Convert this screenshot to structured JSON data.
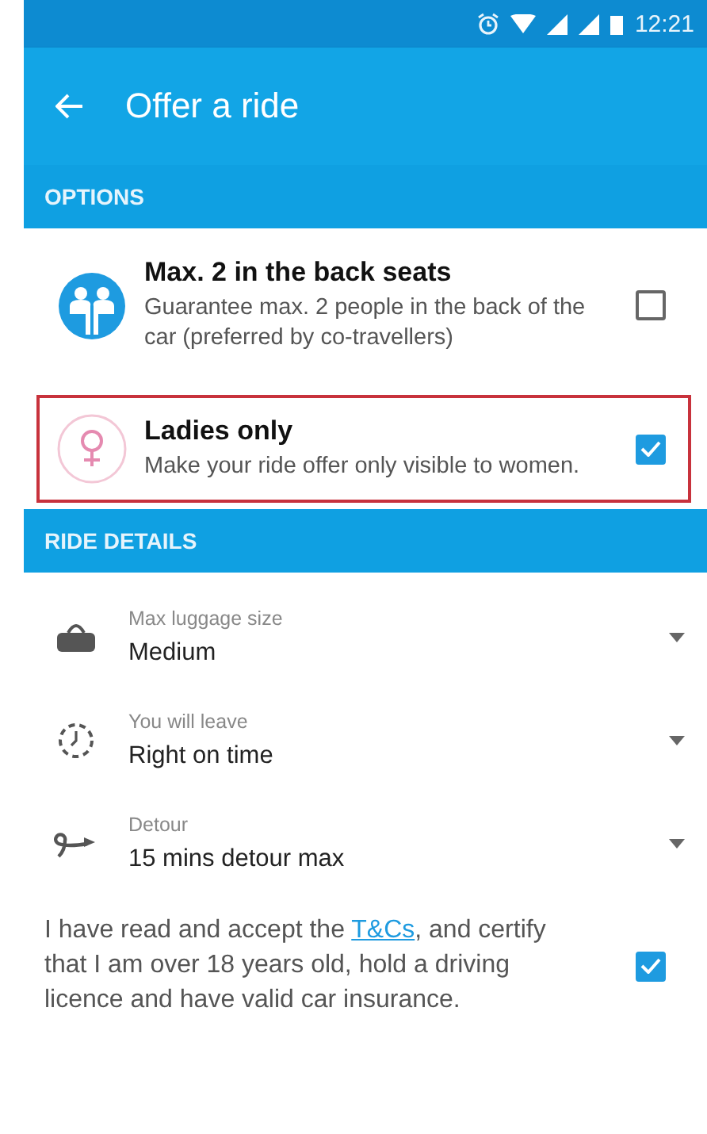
{
  "status_bar": {
    "time": "12:21"
  },
  "app_bar": {
    "title": "Offer a ride"
  },
  "sections": [
    {
      "title": "OPTIONS"
    },
    {
      "title": "RIDE DETAILS"
    }
  ],
  "options": [
    {
      "kind": "seats",
      "title": "Max. 2 in the back seats",
      "description": "Guarantee max. 2 people in the back of the car (preferred by co-travellers)",
      "checked": false,
      "highlighted": false
    },
    {
      "kind": "ladies",
      "title": "Ladies only",
      "description": "Make your ride offer only visible to women.",
      "checked": true,
      "highlighted": true
    }
  ],
  "details": [
    {
      "kind": "luggage",
      "label": "Max luggage size",
      "value": "Medium"
    },
    {
      "kind": "clock",
      "label": "You will leave",
      "value": "Right on time"
    },
    {
      "kind": "detour",
      "label": "Detour",
      "value": "15 mins detour max"
    }
  ],
  "terms": {
    "before": "I have read and accept the ",
    "link": "T&Cs",
    "after": ", and certify that I am over 18 years old, hold a driving licence and have valid car insurance.",
    "checked": true
  }
}
